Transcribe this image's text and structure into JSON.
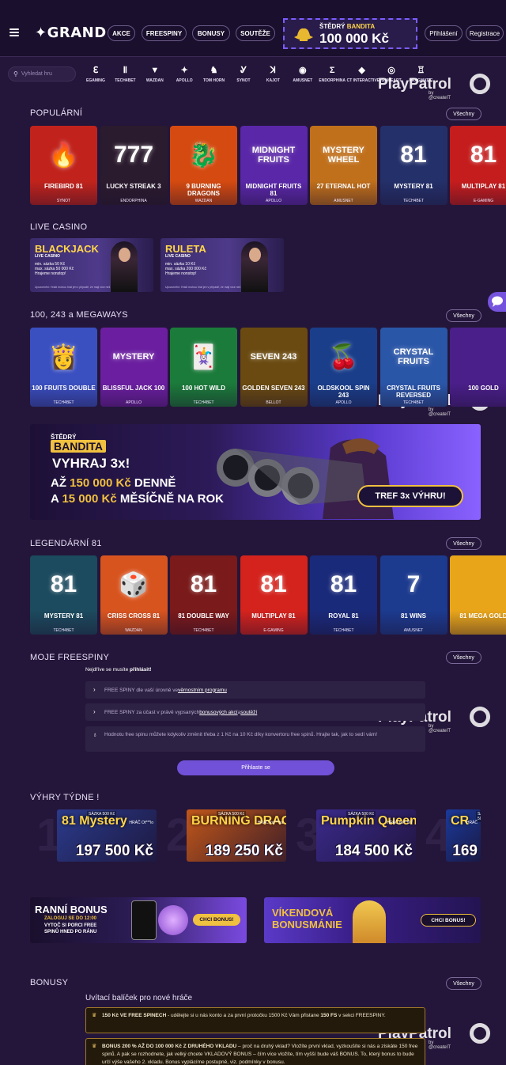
{
  "header": {
    "logo": "GRAND",
    "nav": [
      "AKCE",
      "FREESPINY",
      "BONUSY",
      "SOUTĚŽE"
    ],
    "promo_line1": "ŠTĚDRÝ",
    "promo_line1b": "BANDITA",
    "promo_line2": "100 000 Kč",
    "login": "Přihlášení",
    "register": "Registrace"
  },
  "providers": {
    "search_placeholder": "Vyhledat hru",
    "items": [
      "EGAMING",
      "TECH4BET",
      "WAZDAN",
      "APOLLO",
      "TOM HORN",
      "SYNOT",
      "KAJOT",
      "AMUSNET",
      "ENDORPHINA",
      "CT INTERACTIVE",
      "GAMEART",
      "PRAGMATIC"
    ]
  },
  "watermark": {
    "brand": "PlayPatrol",
    "by": "by @createIT"
  },
  "all_label": "Všechny",
  "popular": {
    "title": "POPULÁRNÍ",
    "games": [
      {
        "name": "FIREBIRD 81",
        "provider": "SYNOT",
        "art": "🔥",
        "bg": "#c1231c"
      },
      {
        "name": "LUCKY STREAK 3",
        "provider": "ENDORPHINA",
        "art": "777",
        "bg": "#2b1b2e"
      },
      {
        "name": "9 BURNING DRAGONS",
        "provider": "WAZDAN",
        "art": "🐉",
        "bg": "#d44a10"
      },
      {
        "name": "MIDNIGHT FRUITS 81",
        "provider": "APOLLO",
        "art": "MIDNIGHT FRUITS",
        "bg": "#5a27a8"
      },
      {
        "name": "27 ETERNAL HOT",
        "provider": "AMUSNET",
        "art": "MYSTERY WHEEL",
        "bg": "#c06f1a"
      },
      {
        "name": "MYSTERY 81",
        "provider": "TECH4BET",
        "art": "81",
        "bg": "#24306a"
      },
      {
        "name": "MULTIPLAY 81",
        "provider": "E-GAMING",
        "art": "81",
        "bg": "#c51d1d"
      }
    ]
  },
  "live_casino": {
    "title": "LIVE CASINO",
    "tables": [
      {
        "name": "BLACKJACK",
        "sub": "LIVE CASINO",
        "info1": "min. sázka 50 Kč",
        "info2": "max. sázka 50 000 Kč",
        "info3": "Hrajeme nonstop!",
        "foot": "Upozornění: Hráči mohou hrát jen v případě, že mají více než 18 let"
      },
      {
        "name": "RULETA",
        "sub": "LIVE CASINO",
        "info1": "min. sázka 10 Kč",
        "info2": "max. sázka 200 000 Kč",
        "info3": "Hrajeme nonstop!",
        "foot": "Upozornění: Hráči mohou hrát jen v případě, že mají více než 18 let"
      }
    ]
  },
  "megaways": {
    "title": "100, 243 a MEGAWAYS",
    "games": [
      {
        "name": "100 FRUITS DOUBLE",
        "provider": "TECH4BET",
        "art": "👸",
        "bg": "#3a4fc0"
      },
      {
        "name": "BLISSFUL JACK 100",
        "provider": "APOLLO",
        "art": "MYSTERY",
        "bg": "#6b1fa0"
      },
      {
        "name": "100 HOT WILD",
        "provider": "TECH4BET",
        "art": "🃏",
        "bg": "#1b7b3a"
      },
      {
        "name": "GOLDEN SEVEN 243",
        "provider": "BELLOT",
        "art": "SEVEN 243",
        "bg": "#6a4a10"
      },
      {
        "name": "OLDSKOOL SPIN 243",
        "provider": "APOLLO",
        "art": "🍒",
        "bg": "#1a3e8a"
      },
      {
        "name": "CRYSTAL FRUITS REVERSED",
        "provider": "TECH4BET",
        "art": "CRYSTAL FRUITS",
        "bg": "#2a56a8"
      },
      {
        "name": "100 GOLD",
        "provider": "",
        "art": "",
        "bg": "#4a1f8a"
      }
    ]
  },
  "bandit_banner": {
    "tag1": "ŠTĚDRÝ",
    "tag2": "BANDITA",
    "line1": "VYHRAJ 3x!",
    "line2a": "AŽ ",
    "line2b": "150 000 Kč",
    "line2c": " DENNĚ",
    "line3a": "A ",
    "line3b": "15 000 Kč",
    "line3c": " MĚSÍČNĚ NA ROK",
    "cta": "TREF 3x VÝHRU!"
  },
  "legendary": {
    "title": "LEGENDÁRNÍ 81",
    "games": [
      {
        "name": "MYSTERY 81",
        "provider": "TECH4BET",
        "art": "81",
        "bg": "#1c4a5e"
      },
      {
        "name": "CRISS CROSS 81",
        "provider": "WAZDAN",
        "art": "🎲",
        "bg": "#d8541f"
      },
      {
        "name": "81 DOUBLE WAY",
        "provider": "TECH4BET",
        "art": "81",
        "bg": "#7a1a1a"
      },
      {
        "name": "MULTIPLAY 81",
        "provider": "E-GAMING",
        "art": "81",
        "bg": "#d4231d"
      },
      {
        "name": "ROYAL 81",
        "provider": "TECH4BET",
        "art": "81",
        "bg": "#1a2a7a"
      },
      {
        "name": "81 WINS",
        "provider": "AMUSNET",
        "art": "7",
        "bg": "#1c3a8e"
      },
      {
        "name": "81 MEGA GOLD",
        "provider": "",
        "art": "",
        "bg": "#e8a51a"
      }
    ]
  },
  "freespins": {
    "title": "MOJE FREESPINY",
    "notice": "Nejdříve se musíte ",
    "notice_link": "přihlásit!",
    "row1_a": "FREE SPINY dle vaší úrovně ve ",
    "row1_link": "věrnostním programu",
    "row2_a": "FREE SPINY za účast v právě vypsaných ",
    "row2_link1": "bonusových akcí",
    "row2_b": " a ",
    "row2_link2": "soutěží",
    "info": "Hodnotu free spinu můžete kdykoliv změnit třeba z 1 Kč na 10 Kč díky konvertoru free spinů. Hrajte tak, jak to sedí vám!",
    "login_btn": "Přihlaste se"
  },
  "weekly_wins": {
    "title": "VÝHRY TÝDNE !",
    "wins": [
      {
        "rank": "1",
        "bet": "SÁZKA 500 Kč",
        "player": "HRÁČ Ot***lo",
        "amount": "197 500 Kč",
        "game": "81 Mystery",
        "bg": "#2a3a8a"
      },
      {
        "rank": "2",
        "bet": "SÁZKA 500 Kč",
        "player": "HRÁČ ka***na",
        "amount": "189 250 Kč",
        "game": "BURNING DRAGONS",
        "bg": "#c0561a"
      },
      {
        "rank": "3",
        "bet": "SÁZKA 500 Kč",
        "player": "HRÁČ pe***97",
        "amount": "184 500 Kč",
        "game": "Pumpkin Queen",
        "bg": "#3a2a8a"
      },
      {
        "rank": "4",
        "bet": "SÁZKA 500 Kč",
        "player": "HRÁČ",
        "amount": "169",
        "game": "CR",
        "bg": "#1a3a9a"
      }
    ]
  },
  "promos": {
    "morning_title": "RANNÍ BONUS",
    "morning_sub1": "ZALOGUJ SE DO 12:00",
    "morning_sub2": "VYTOČ SI PORCI FREE",
    "morning_sub3": "SPINŮ HNED PO RÁNU",
    "weekend_title1": "VÍKENDOVÁ",
    "weekend_title2": "BONUSMÁNIE",
    "cta": "CHCI BONUS!"
  },
  "bonuses": {
    "title": "BONUSY",
    "subtitle": "Uvítací balíček pro nové hráče",
    "row1_bold": "150 Kč VE FREE SPINECH",
    "row1_text": " - udělejte si u nás konto a za první protočku 1500 Kč Vám přistane ",
    "row1_bold2": "150 FS",
    "row1_text2": " v sekci FREESPINY.",
    "row2_bold": "BONUS 200 % AŽ DO 100 000 Kč Z DRUHÉHO VKLADU",
    "row2_text": " – proč na druhý vklad? Vložíte první vklad, vyzkoušíte si nás a získáte 150 free spinů. A pak se rozhodnete, jak velký chcete VKLADOVÝ BONUS – čím více vložíte, tím vyšší bude váš BONUS. To, který bonus to bude určí výše vašeho 2. vkladu. Bonus vyplácíme postupně, viz. podmínky v bonusu."
  },
  "colors": {
    "bg": "#24163a",
    "header": "#1a0f2c",
    "accent": "#7151d8",
    "gold": "#ffd54a"
  }
}
